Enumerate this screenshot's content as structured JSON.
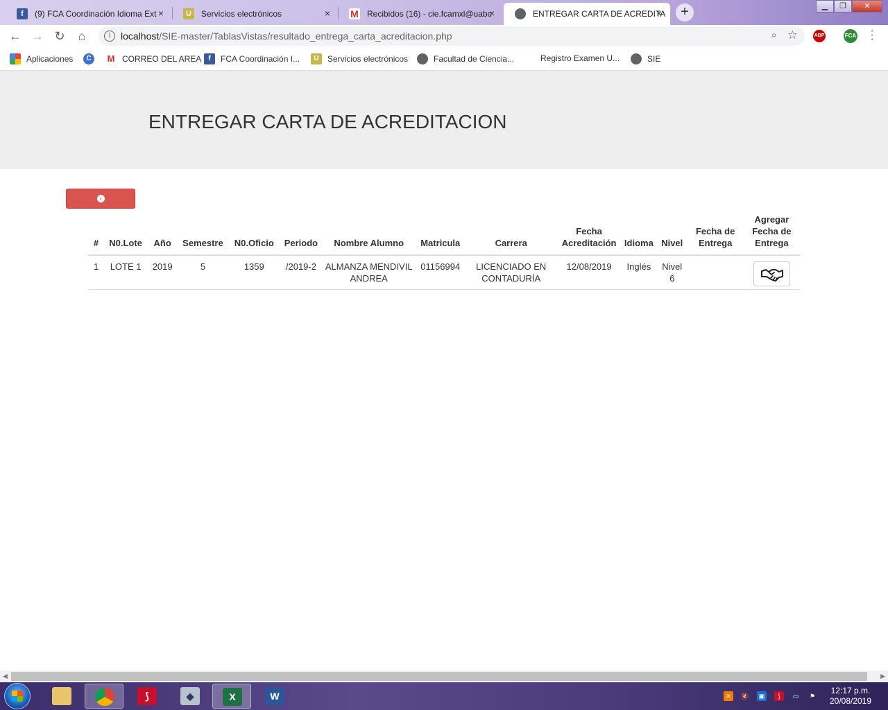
{
  "browser": {
    "tabs": [
      {
        "title": "(9) FCA Coordinación Idioma Ext",
        "icon": "facebook-icon",
        "active": false
      },
      {
        "title": "Servicios electrónicos",
        "icon": "uabc-shield-icon",
        "active": false
      },
      {
        "title": "Recibidos (16) - cie.fcamxl@uabc",
        "icon": "gmail-icon",
        "active": false
      },
      {
        "title": "ENTREGAR CARTA DE ACREDITA",
        "icon": "globe-icon",
        "active": true
      }
    ],
    "close_glyph": "×",
    "new_tab_glyph": "+",
    "url_host": "localhost",
    "url_path": "/SIE-master/TablasVistas/resultado_entrega_carta_acreditacion.php",
    "ext_abp": "ABP",
    "ext_fca": "FCA",
    "bookmarks": [
      {
        "label": "Aplicaciones",
        "icon": "apps-grid-icon"
      },
      {
        "label": "",
        "icon": "cengage-icon"
      },
      {
        "label": "CORREO DEL AREA",
        "icon": "gmail-icon"
      },
      {
        "label": "FCA Coordinación I...",
        "icon": "facebook-icon"
      },
      {
        "label": "Servicios electrónicos",
        "icon": "uabc-shield-icon"
      },
      {
        "label": "Facultad de Ciencia...",
        "icon": "globe-icon"
      },
      {
        "label": "Registro Examen U...",
        "icon": ""
      },
      {
        "label": "SIE",
        "icon": "globe-icon"
      }
    ]
  },
  "page": {
    "title": "ENTREGAR CARTA DE ACREDITACION",
    "back_button_icon": "arrow-circle-left-icon",
    "table": {
      "headers": [
        "#",
        "N0.Lote",
        "Año",
        "Semestre",
        "N0.Oficio",
        "Periodo",
        "Nombre Alumno",
        "Matricula",
        "Carrera",
        "Fecha Acreditación",
        "Idioma",
        "Nivel",
        "Fecha de Entrega",
        "Agregar Fecha de Entrega"
      ],
      "rows": [
        {
          "num": "1",
          "lote": "LOTE 1",
          "anio": "2019",
          "semestre": "5",
          "oficio": "1359",
          "periodo": "/2019-2",
          "nombre": "ALMANZA MENDIVIL ANDREA",
          "matricula": "01156994",
          "carrera": "LICENCIADO EN CONTADURÍA",
          "fecha_acreditacion": "12/08/2019",
          "idioma": "Inglés",
          "nivel": "Nivel 6",
          "fecha_entrega": "",
          "action_icon": "handshake-icon"
        }
      ]
    }
  },
  "taskbar": {
    "apps": [
      "file-explorer-icon",
      "chrome-icon",
      "acrobat-icon",
      "certificate-tool-icon",
      "excel-icon",
      "word-icon"
    ],
    "time": "12:17 p.m.",
    "date": "20/08/2019"
  }
}
